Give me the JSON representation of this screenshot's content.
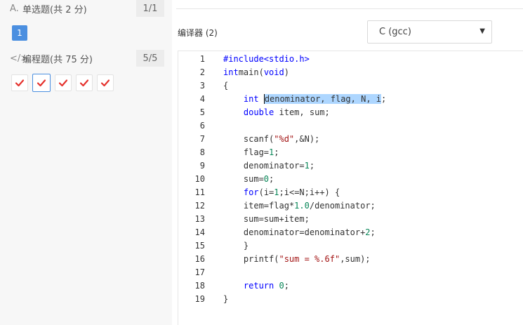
{
  "sidebar": {
    "section1": {
      "icon_glyph": "A.",
      "icon_name": "single-choice-icon",
      "title": "单选题(共 2 分)",
      "count": "1/1",
      "question_label": "1"
    },
    "section2": {
      "icon_glyph": "</>",
      "icon_name": "code-icon",
      "title": "编程题(共 75 分)",
      "count": "5/5",
      "check_count": 5,
      "active_index": 1
    }
  },
  "main": {
    "compiler_label": "编译器 (2)",
    "compiler_select": {
      "value": "C (gcc)"
    }
  },
  "editor": {
    "line_numbers": [
      "1",
      "2",
      "3",
      "4",
      "5",
      "6",
      "7",
      "8",
      "9",
      "10",
      "11",
      "12",
      "13",
      "14",
      "15",
      "16",
      "17",
      "18",
      "19"
    ],
    "lines": [
      [
        [
          "pp",
          "#include<stdio.h>"
        ]
      ],
      [
        [
          "kw",
          "int"
        ],
        [
          "",
          "main("
        ],
        [
          "kw",
          "void"
        ],
        [
          "",
          ")"
        ]
      ],
      [
        [
          "",
          "{"
        ]
      ],
      [
        [
          "",
          "    "
        ],
        [
          "kw",
          "int"
        ],
        [
          "",
          "·"
        ],
        [
          "sel",
          "denominator, flag, N, i"
        ],
        [
          "",
          ";"
        ]
      ],
      [
        [
          "",
          "    "
        ],
        [
          "kw",
          "double"
        ],
        [
          "",
          " item, sum;"
        ]
      ],
      [],
      [
        [
          "",
          "    scanf("
        ],
        [
          "str",
          "\"%d\""
        ],
        [
          "",
          ",&N);"
        ]
      ],
      [
        [
          "",
          "    flag="
        ],
        [
          "num",
          "1"
        ],
        [
          "",
          ";"
        ]
      ],
      [
        [
          "",
          "    denominator="
        ],
        [
          "num",
          "1"
        ],
        [
          "",
          ";"
        ]
      ],
      [
        [
          "",
          "    sum="
        ],
        [
          "num",
          "0"
        ],
        [
          "",
          ";"
        ]
      ],
      [
        [
          "",
          "    "
        ],
        [
          "kw",
          "for"
        ],
        [
          "",
          "(i="
        ],
        [
          "num",
          "1"
        ],
        [
          "",
          ";i<=N;i++) {"
        ]
      ],
      [
        [
          "",
          "    item=flag*"
        ],
        [
          "num",
          "1.0"
        ],
        [
          "",
          "/denominator;"
        ]
      ],
      [
        [
          "",
          "    sum=sum+item;"
        ]
      ],
      [
        [
          "",
          "    denominator=denominator+"
        ],
        [
          "num",
          "2"
        ],
        [
          "",
          ";"
        ]
      ],
      [
        [
          "",
          "    }"
        ]
      ],
      [
        [
          "",
          "    printf("
        ],
        [
          "str",
          "\"sum = %.6f\""
        ],
        [
          "",
          ",sum);"
        ]
      ],
      [],
      [
        [
          "",
          "    "
        ],
        [
          "kw",
          "return"
        ],
        [
          "",
          " "
        ],
        [
          "num",
          "0"
        ],
        [
          "",
          ";"
        ]
      ],
      [
        [
          "",
          "}"
        ]
      ]
    ]
  },
  "colors": {
    "accent": "#4b8fe0",
    "check": "#e5322d",
    "selection": "#add6ff"
  }
}
